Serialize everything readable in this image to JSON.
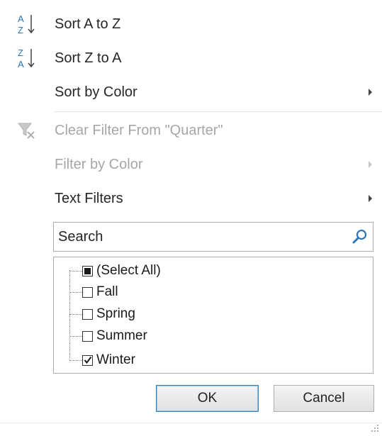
{
  "menu": {
    "sort_a_to_z": "Sort A to Z",
    "sort_z_to_a": "Sort Z to A",
    "sort_by_color": "Sort by Color",
    "clear_filter": "Clear Filter From \"Quarter\"",
    "filter_by_color": "Filter by Color",
    "text_filters": "Text Filters"
  },
  "search": {
    "placeholder": "Search",
    "value": ""
  },
  "list": {
    "items": [
      {
        "label": "(Select All)",
        "state": "partial"
      },
      {
        "label": "Fall",
        "state": "unchecked"
      },
      {
        "label": "Spring",
        "state": "unchecked"
      },
      {
        "label": "Summer",
        "state": "unchecked"
      },
      {
        "label": "Winter",
        "state": "checked"
      }
    ]
  },
  "buttons": {
    "ok": "OK",
    "cancel": "Cancel"
  },
  "icons": {
    "sort_ascending": "sort-a-z-icon",
    "sort_descending": "sort-z-a-icon",
    "clear_filter": "clear-filter-icon",
    "search": "search-icon"
  },
  "colors": {
    "accent_blue": "#3c7fb1",
    "icon_blue": "#2e75b6",
    "disabled_text": "#a6a6a6"
  }
}
